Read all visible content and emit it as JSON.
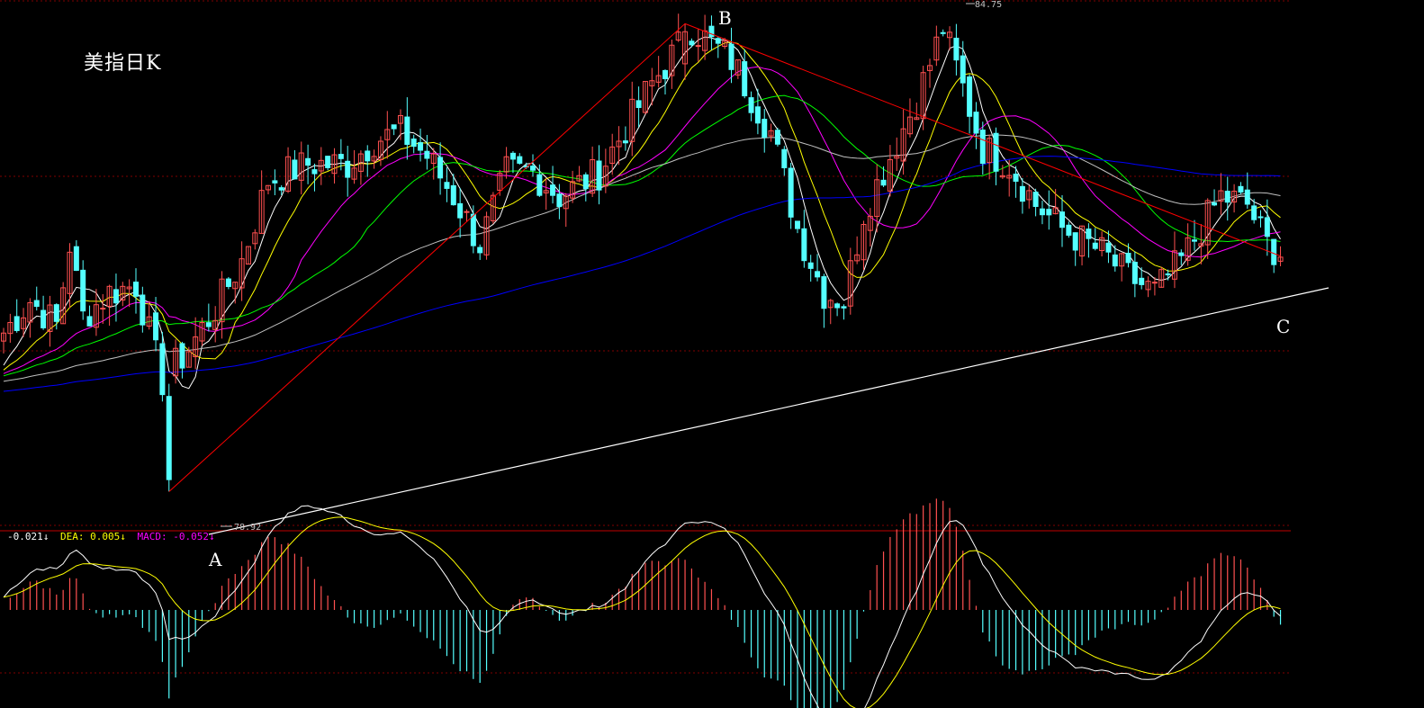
{
  "title": "美指日K",
  "points": {
    "a": "A",
    "b": "B",
    "c": "C"
  },
  "price_high": "84.75",
  "price_low": "78.92",
  "macd_legend": {
    "diff": "-0.021↓",
    "dea": "DEA: 0.005↓",
    "macd": "MACD: -0.052↓"
  },
  "colors": {
    "background": "#000000",
    "up_candle": "#ff5050",
    "down_candle": "#54ffff",
    "ma5": "#ffffff",
    "ma10": "#ffff00",
    "ma20": "#ff00ff",
    "ma30": "#00ff00",
    "ma60": "#c0c0c0",
    "ma120": "#0000ff",
    "trend_red": "#ff0000",
    "trend_white": "#ffffff",
    "grid": "#800000"
  },
  "chart_data": {
    "type": "candlestick",
    "ylim": [
      78.5,
      85.0
    ],
    "close_path": [
      [
        0,
        80.9
      ],
      [
        4,
        81.3
      ],
      [
        8,
        81.0
      ],
      [
        10,
        82.0
      ],
      [
        12,
        81.1
      ],
      [
        16,
        81.4
      ],
      [
        20,
        81.5
      ],
      [
        24,
        80.3
      ],
      [
        28,
        80.7
      ],
      [
        32,
        81.2
      ],
      [
        36,
        81.8
      ],
      [
        40,
        82.8
      ],
      [
        46,
        83.0
      ],
      [
        52,
        83.0
      ],
      [
        56,
        83.3
      ],
      [
        60,
        83.4
      ],
      [
        64,
        83.1
      ],
      [
        68,
        82.6
      ],
      [
        72,
        82.0
      ],
      [
        76,
        82.9
      ],
      [
        80,
        82.9
      ],
      [
        84,
        82.6
      ],
      [
        90,
        82.9
      ],
      [
        98,
        84.0
      ],
      [
        104,
        84.7
      ],
      [
        110,
        84.3
      ],
      [
        116,
        83.4
      ],
      [
        120,
        82.2
      ],
      [
        124,
        81.4
      ],
      [
        127,
        81.3
      ],
      [
        130,
        82.4
      ],
      [
        134,
        83.1
      ],
      [
        138,
        83.8
      ],
      [
        142,
        84.7
      ],
      [
        144,
        84.2
      ],
      [
        148,
        83.2
      ],
      [
        152,
        83.0
      ],
      [
        156,
        82.5
      ],
      [
        160,
        82.2
      ],
      [
        166,
        81.9
      ],
      [
        170,
        81.6
      ],
      [
        174,
        81.4
      ],
      [
        178,
        81.8
      ],
      [
        184,
        82.6
      ],
      [
        188,
        82.5
      ],
      [
        191,
        82.0
      ],
      [
        193,
        81.9
      ]
    ],
    "markers": [
      {
        "label": "A",
        "index": 25,
        "price": 78.92
      },
      {
        "label": "B",
        "index": 103,
        "price": 84.75
      },
      {
        "label": "C",
        "index": 193,
        "price": 81.9
      }
    ],
    "moving_averages": [
      "MA5",
      "MA10",
      "MA20",
      "MA30",
      "MA60",
      "MA120"
    ],
    "macd": {
      "diff": -0.021,
      "dea": 0.005,
      "macd": -0.052
    },
    "grid": true
  }
}
